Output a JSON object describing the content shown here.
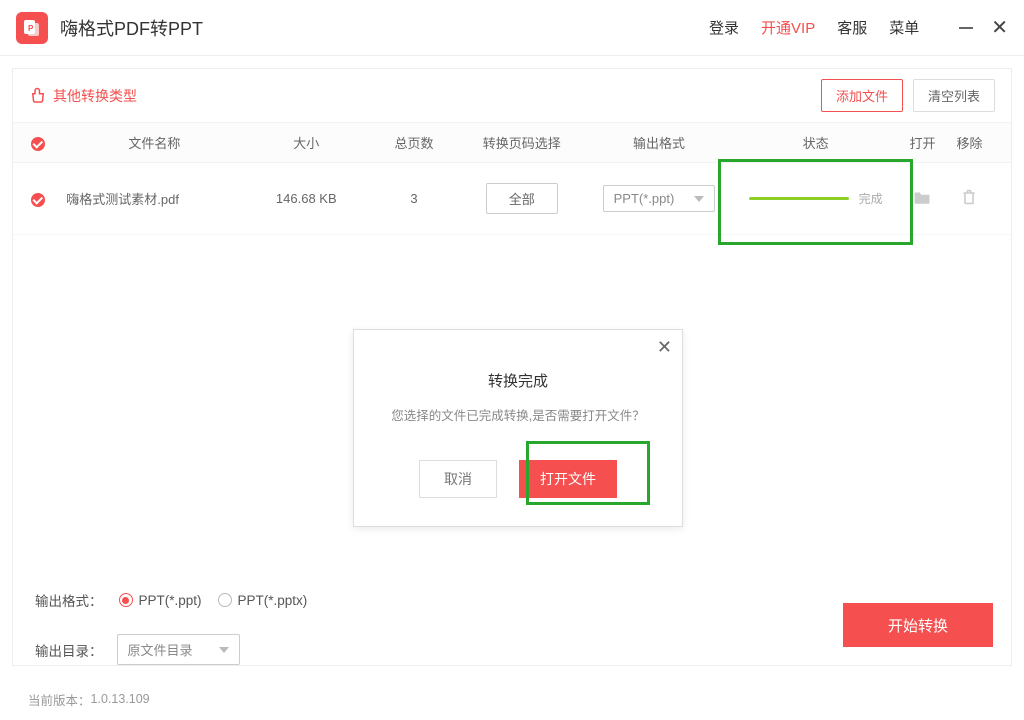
{
  "app": {
    "title": "嗨格式PDF转PPT"
  },
  "titlebar": {
    "login": "登录",
    "vip": "开通VIP",
    "service": "客服",
    "menu": "菜单"
  },
  "toolbar": {
    "other_types": "其他转换类型",
    "add_files": "添加文件",
    "clear_list": "清空列表"
  },
  "table": {
    "headers": {
      "filename": "文件名称",
      "size": "大小",
      "pages": "总页数",
      "pagesel": "转换页码选择",
      "outfmt": "输出格式",
      "status": "状态",
      "open": "打开",
      "remove": "移除"
    },
    "row": {
      "filename": "嗨格式测试素材.pdf",
      "size": "146.68 KB",
      "pages": "3",
      "pagesel": "全部",
      "outfmt": "PPT(*.ppt)",
      "status": "完成"
    }
  },
  "modal": {
    "title": "转换完成",
    "message": "您选择的文件已完成转换,是否需要打开文件？",
    "cancel": "取消",
    "open": "打开文件"
  },
  "options": {
    "outfmt_label": "输出格式：",
    "fmt_ppt": "PPT(*.ppt)",
    "fmt_pptx": "PPT(*.pptx)",
    "outdir_label": "输出目录：",
    "outdir_value": "原文件目录"
  },
  "actions": {
    "start": "开始转换"
  },
  "footer": {
    "version_label": "当前版本：",
    "version": "1.0.13.109"
  }
}
